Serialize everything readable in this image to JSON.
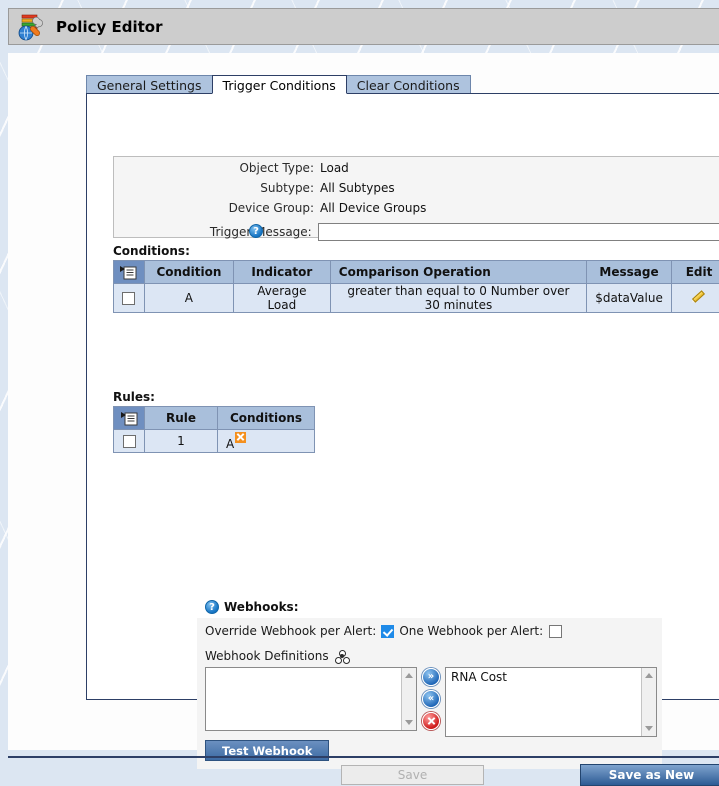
{
  "window": {
    "title": "Policy Editor",
    "icon": "policy-editor-icon"
  },
  "tabs": [
    {
      "label": "General Settings",
      "active": false
    },
    {
      "label": "Trigger Conditions",
      "active": true
    },
    {
      "label": "Clear Conditions",
      "active": false
    }
  ],
  "info": {
    "object_type_label": "Object Type:",
    "object_type_value": "Load",
    "subtype_label": "Subtype:",
    "subtype_value": "All Subtypes",
    "device_group_label": "Device Group:",
    "device_group_value": "All Device Groups",
    "trigger_message_label": "Trigger Message:",
    "trigger_message_value": "",
    "trigger_message_placeholder": ""
  },
  "conditions": {
    "section_label": "Conditions:",
    "columns": [
      "",
      "Condition",
      "Indicator",
      "Comparison Operation",
      "Message",
      "Edit"
    ],
    "rows": [
      {
        "checked": false,
        "condition": "A",
        "indicator": "Average Load",
        "comparison": "greater than equal to 0 Number over 30 minutes",
        "message": "$dataValue",
        "edit_icon": "pencil-icon"
      }
    ]
  },
  "rules": {
    "section_label": "Rules:",
    "columns": [
      "",
      "Rule",
      "Conditions"
    ],
    "rows": [
      {
        "checked": false,
        "rule": "1",
        "conditions": "A",
        "remove_icon": "remove-x-icon"
      }
    ]
  },
  "webhooks": {
    "section_label": "Webhooks:",
    "override_label": "Override Webhook per Alert:",
    "override_checked": true,
    "one_per_alert_label": "One Webhook per Alert:",
    "one_per_alert_checked": false,
    "definitions_label": "Webhook Definitions",
    "definitions_icon": "network-share-icon",
    "available_items": [],
    "selected_items": [
      "RNA Cost"
    ],
    "add_button_icon": "double-chevron-right-icon",
    "remove_button_icon": "double-chevron-left-icon",
    "delete_button_icon": "delete-x-icon",
    "test_button_label": "Test Webhook"
  },
  "footer": {
    "save_label": "Save",
    "save_disabled": true,
    "save_as_new_label": "Save as New"
  },
  "colors": {
    "accent_blue": "#2d5b94",
    "grid_header": "#a9bfdb",
    "grid_row": "#dce6f4",
    "checkbox_checked": "#1e8ae8",
    "backdrop": "#dce6f2"
  }
}
